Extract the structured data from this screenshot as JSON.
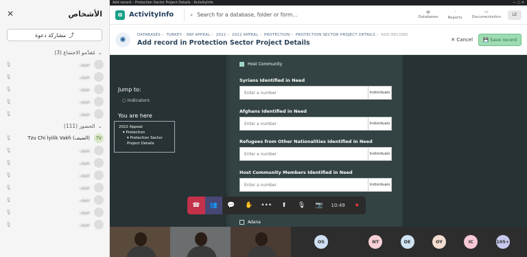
{
  "window": {
    "title": "Add record – Protection Sector Project Details - ActivityInfo"
  },
  "people_panel": {
    "title": "الأشخاص",
    "invite_label": "مشاركة دعوة",
    "lobby_section": "مُقدّمو الاجتماع (3)",
    "present_section": "الحضور (111)",
    "blurred_rows": [
      {
        "name": "ضيف"
      },
      {
        "name": "ضيف"
      },
      {
        "name": "ضيف"
      },
      {
        "name": "ضيف"
      },
      {
        "name": "ضيف"
      },
      {
        "name": "ضيف"
      },
      {
        "name": "ضيف"
      },
      {
        "name": "ضيف"
      },
      {
        "name": "ضيف"
      },
      {
        "name": "ضيف"
      },
      {
        "name": "ضيف"
      },
      {
        "name": "ضيف"
      }
    ],
    "named_row": {
      "initials": "TV",
      "name": "(الضيف) Tzu Chi İyilik Vakfı"
    }
  },
  "app": {
    "brand": "ActivityInfo",
    "search_placeholder": "Search for a database, folder or form...",
    "nav": [
      "Databases",
      "Reports",
      "Documentation"
    ],
    "user_initials": "LE",
    "breadcrumbs": [
      "DATABASES",
      "TURKEY - 3RP APPEAL",
      "2022",
      "2022 APPEAL",
      "PROTECTION",
      "PROTECTION SECTOR PROJECT DETAILS",
      "ADD RECORD"
    ],
    "page_title": "Add record in Protection Sector Project Details",
    "cancel_label": "Cancel",
    "save_label": "Save record",
    "jump_to": "Jump to:",
    "jump_items": [
      "Indicators"
    ],
    "you_are_here": "You are here",
    "location": [
      "2022 Appeal",
      "Protection",
      "Protection Sector Project Details"
    ],
    "host_checkbox": "Host Community",
    "fields": [
      {
        "label": "Syrians Identified in Need",
        "placeholder": "Enter a number",
        "unit": "Individuals"
      },
      {
        "label": "Afghans Identified in Need",
        "placeholder": "Enter a number",
        "unit": "Individuals"
      },
      {
        "label": "Refugees from Other Nationalities Identified in Need",
        "placeholder": "Enter a number",
        "unit": "Individuals"
      },
      {
        "label": "Host Community Members Identified in Need",
        "placeholder": "Enter a number",
        "unit": "Individuals"
      }
    ],
    "adana_checkbox": "Adana"
  },
  "controls": {
    "timer": "10:49"
  },
  "participants": [
    "OS",
    "NT",
    "DE",
    "OY",
    "IC",
    "105+"
  ],
  "participant_colors": [
    "#cfe0f4",
    "#f6d0d6",
    "#cfe3f3",
    "#f3dcd0",
    "#f7c8d6",
    "#c8c8ee"
  ]
}
